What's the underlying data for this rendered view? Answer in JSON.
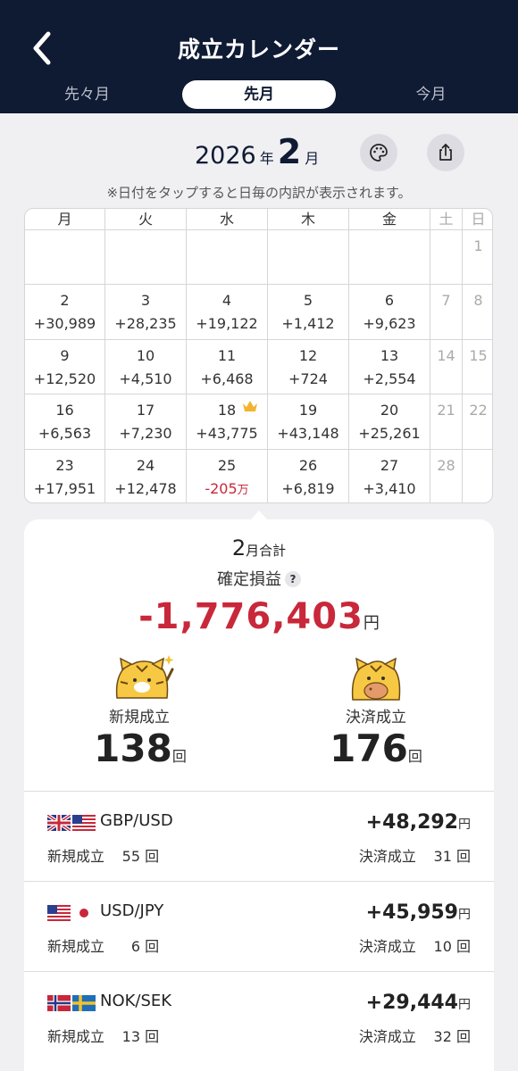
{
  "header": {
    "title": "成立カレンダー",
    "tabs": [
      {
        "label": "先々月",
        "selected": false
      },
      {
        "label": "先月",
        "selected": true
      },
      {
        "label": "今月",
        "selected": false
      }
    ]
  },
  "month": {
    "year": "2026",
    "year_unit": "年",
    "month": "2",
    "month_unit": "月"
  },
  "hint": "※日付をタップすると日毎の内訳が表示されます。",
  "weekdays": [
    "月",
    "火",
    "水",
    "木",
    "金",
    "土",
    "日"
  ],
  "calendar": [
    [
      null,
      null,
      null,
      null,
      null,
      null,
      {
        "d": "1"
      }
    ],
    [
      {
        "d": "2",
        "v": "+30,989"
      },
      {
        "d": "3",
        "v": "+28,235"
      },
      {
        "d": "4",
        "v": "+19,122"
      },
      {
        "d": "5",
        "v": "+1,412"
      },
      {
        "d": "6",
        "v": "+9,623"
      },
      {
        "d": "7"
      },
      {
        "d": "8"
      }
    ],
    [
      {
        "d": "9",
        "v": "+12,520"
      },
      {
        "d": "10",
        "v": "+4,510"
      },
      {
        "d": "11",
        "v": "+6,468"
      },
      {
        "d": "12",
        "v": "+724"
      },
      {
        "d": "13",
        "v": "+2,554"
      },
      {
        "d": "14"
      },
      {
        "d": "15"
      }
    ],
    [
      {
        "d": "16",
        "v": "+6,563"
      },
      {
        "d": "17",
        "v": "+7,230"
      },
      {
        "d": "18",
        "v": "+43,775",
        "crown": true
      },
      {
        "d": "19",
        "v": "+43,148"
      },
      {
        "d": "20",
        "v": "+25,261"
      },
      {
        "d": "21"
      },
      {
        "d": "22"
      }
    ],
    [
      {
        "d": "23",
        "v": "+17,951"
      },
      {
        "d": "24",
        "v": "+12,478"
      },
      {
        "d": "25",
        "v": "-205",
        "unit": "万",
        "neg": true
      },
      {
        "d": "26",
        "v": "+6,819"
      },
      {
        "d": "27",
        "v": "+3,410"
      },
      {
        "d": "28"
      },
      null
    ]
  ],
  "summary": {
    "month_num": "2",
    "month_total_label": "月合計",
    "confirmed_label": "確定損益",
    "help_glyph": "?",
    "total": "-1,776,403",
    "yen": "円",
    "new_label": "新規成立",
    "new_count": "138",
    "settle_label": "決済成立",
    "settle_count": "176",
    "count_unit": "回"
  },
  "pairs": [
    {
      "name": "GBP/USD",
      "pl": "+48,292",
      "yen": "円",
      "new_label": "新規成立",
      "new": "55",
      "settle_label": "決済成立",
      "settle": "31",
      "unit": "回",
      "flags": [
        "uk-flag-icon",
        "us-flag-icon"
      ]
    },
    {
      "name": "USD/JPY",
      "pl": "+45,959",
      "yen": "円",
      "new_label": "新規成立",
      "new": "6",
      "settle_label": "決済成立",
      "settle": "10",
      "unit": "回",
      "flags": [
        "us-flag-icon",
        "jp-flag-icon"
      ]
    },
    {
      "name": "NOK/SEK",
      "pl": "+29,444",
      "yen": "円",
      "new_label": "新規成立",
      "new": "13",
      "settle_label": "決済成立",
      "settle": "32",
      "unit": "回",
      "flags": [
        "no-flag-icon",
        "se-flag-icon"
      ]
    }
  ],
  "colors": {
    "header_bg": "#0f1a33",
    "negative": "#c8283a",
    "tiger": "#f7c843"
  },
  "icons": {
    "back": "chevron-left-icon",
    "palette": "palette-icon",
    "share": "share-icon",
    "crown": "crown-icon"
  }
}
